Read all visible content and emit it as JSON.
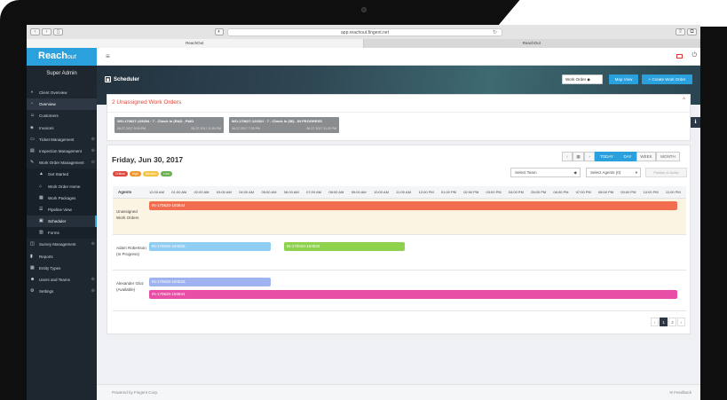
{
  "browser": {
    "url": "app.reachout.fingent.net",
    "tabs": [
      "ReachOut",
      "ReachOut"
    ]
  },
  "sidebar": {
    "logo_main": "Reach",
    "logo_sub": "out",
    "user_role": "Super Admin",
    "items": [
      {
        "label": "Client Overview",
        "icon": "dashboard-icon",
        "expand": ""
      },
      {
        "label": "Overview",
        "icon": "pie-chart-icon",
        "expand": ""
      },
      {
        "label": "Customers",
        "icon": "users-icon",
        "expand": ""
      },
      {
        "label": "Invoices",
        "icon": "money-icon",
        "expand": ""
      },
      {
        "label": "Ticket Management",
        "icon": "monitor-icon",
        "expand": "⊕"
      },
      {
        "label": "Inspection Management",
        "icon": "clipboard-icon",
        "expand": "⊕"
      },
      {
        "label": "Work Order Management",
        "icon": "wrench-icon",
        "expand": "⊖"
      },
      {
        "label": "Get Started",
        "icon": "rocket-icon",
        "expand": ""
      },
      {
        "label": "Work Order Home",
        "icon": "home-icon",
        "expand": ""
      },
      {
        "label": "Work Packages",
        "icon": "package-icon",
        "expand": ""
      },
      {
        "label": "Pipeline View",
        "icon": "pipeline-icon",
        "expand": ""
      },
      {
        "label": "Scheduler",
        "icon": "calendar-icon",
        "expand": ""
      },
      {
        "label": "Forms",
        "icon": "form-icon",
        "expand": ""
      },
      {
        "label": "Survey Management",
        "icon": "chat-icon",
        "expand": "⊕"
      },
      {
        "label": "Reports",
        "icon": "report-icon",
        "expand": ""
      },
      {
        "label": "Entity Types",
        "icon": "grid-icon",
        "expand": ""
      },
      {
        "label": "Users and Teams",
        "icon": "user-icon",
        "expand": "⊕"
      },
      {
        "label": "Settings",
        "icon": "gear-icon",
        "expand": "⊕"
      }
    ]
  },
  "header": {
    "title": "Scheduler",
    "select_value": "Work Order",
    "map_view_label": "Map View",
    "create_label": "+ Create Work Order"
  },
  "unassigned": {
    "title": "2 Unassigned Work Orders",
    "cards": [
      {
        "title": "WO-170627-125254 · 7 - Check In (RAD - PAID",
        "start": "06-27-2017 5:00 PM",
        "end": "06-27-2017 11:00 PM"
      },
      {
        "title": "WO-170627-123321 · 7 - Check In (56) - IN PROGRESS",
        "start": "06-27-2017 7:30 PM",
        "end": "06-27-2017 11:30 PM"
      }
    ]
  },
  "scheduler": {
    "date": "Friday, Jun 30, 2017",
    "legend": [
      {
        "label": "Critical",
        "color": "#e0453a"
      },
      {
        "label": "High",
        "color": "#f0932b"
      },
      {
        "label": "Medium",
        "color": "#f5c242"
      },
      {
        "label": "Low",
        "color": "#6ab04c"
      }
    ],
    "nav": {
      "prev": "‹",
      "cal": "▦",
      "next": "›",
      "today": "TODAY",
      "day": "DAY",
      "week": "WEEK",
      "month": "MONTH"
    },
    "team_select": "Select Team",
    "agents_select": "Select Agents (0)",
    "publish_label": "Publish & Notify",
    "agents_header": "Agents",
    "hours": [
      "12:00 AM",
      "01:00 AM",
      "02:00 AM",
      "03:00 AM",
      "04:00 AM",
      "05:00 AM",
      "06:00 AM",
      "07:00 AM",
      "08:00 AM",
      "09:00 AM",
      "10:00 AM",
      "11:00 AM",
      "12:00 PM",
      "01:00 PM",
      "02:00 PM",
      "03:00 PM",
      "04:00 PM",
      "05:00 PM",
      "06:00 PM",
      "07:00 PM",
      "08:00 PM",
      "09:00 PM",
      "10:00 PM",
      "11:00 PM"
    ],
    "rows": [
      {
        "label": "Unassigned Work Orders",
        "bars": [
          {
            "text": "IN-170620-193844",
            "color": "#f26c4f",
            "start": 0,
            "end": 23.5
          }
        ]
      },
      {
        "label": "Adam Robertson (In Progress)",
        "bars": [
          {
            "text": "IN-170620-184833",
            "color": "#8fcdf2",
            "start": 0,
            "end": 5.4
          },
          {
            "text": "IN-170620-184833",
            "color": "#8ed14c",
            "start": 6,
            "end": 11.4
          }
        ]
      },
      {
        "label": "Alexander Gloz (Available)",
        "bars": [
          {
            "text": "IN-170620-184833",
            "color": "#9fb3f0",
            "start": 0,
            "end": 5.4
          },
          {
            "text": "IN-170620-193844",
            "color": "#e94ea6",
            "start": 0,
            "end": 23.5
          }
        ]
      }
    ],
    "pager": {
      "prev": "‹",
      "page1": "1",
      "page2": "2",
      "next": "›"
    }
  },
  "footer": {
    "powered": "Powered by Fingent Corp.",
    "feedback": "✉ Feedback"
  }
}
